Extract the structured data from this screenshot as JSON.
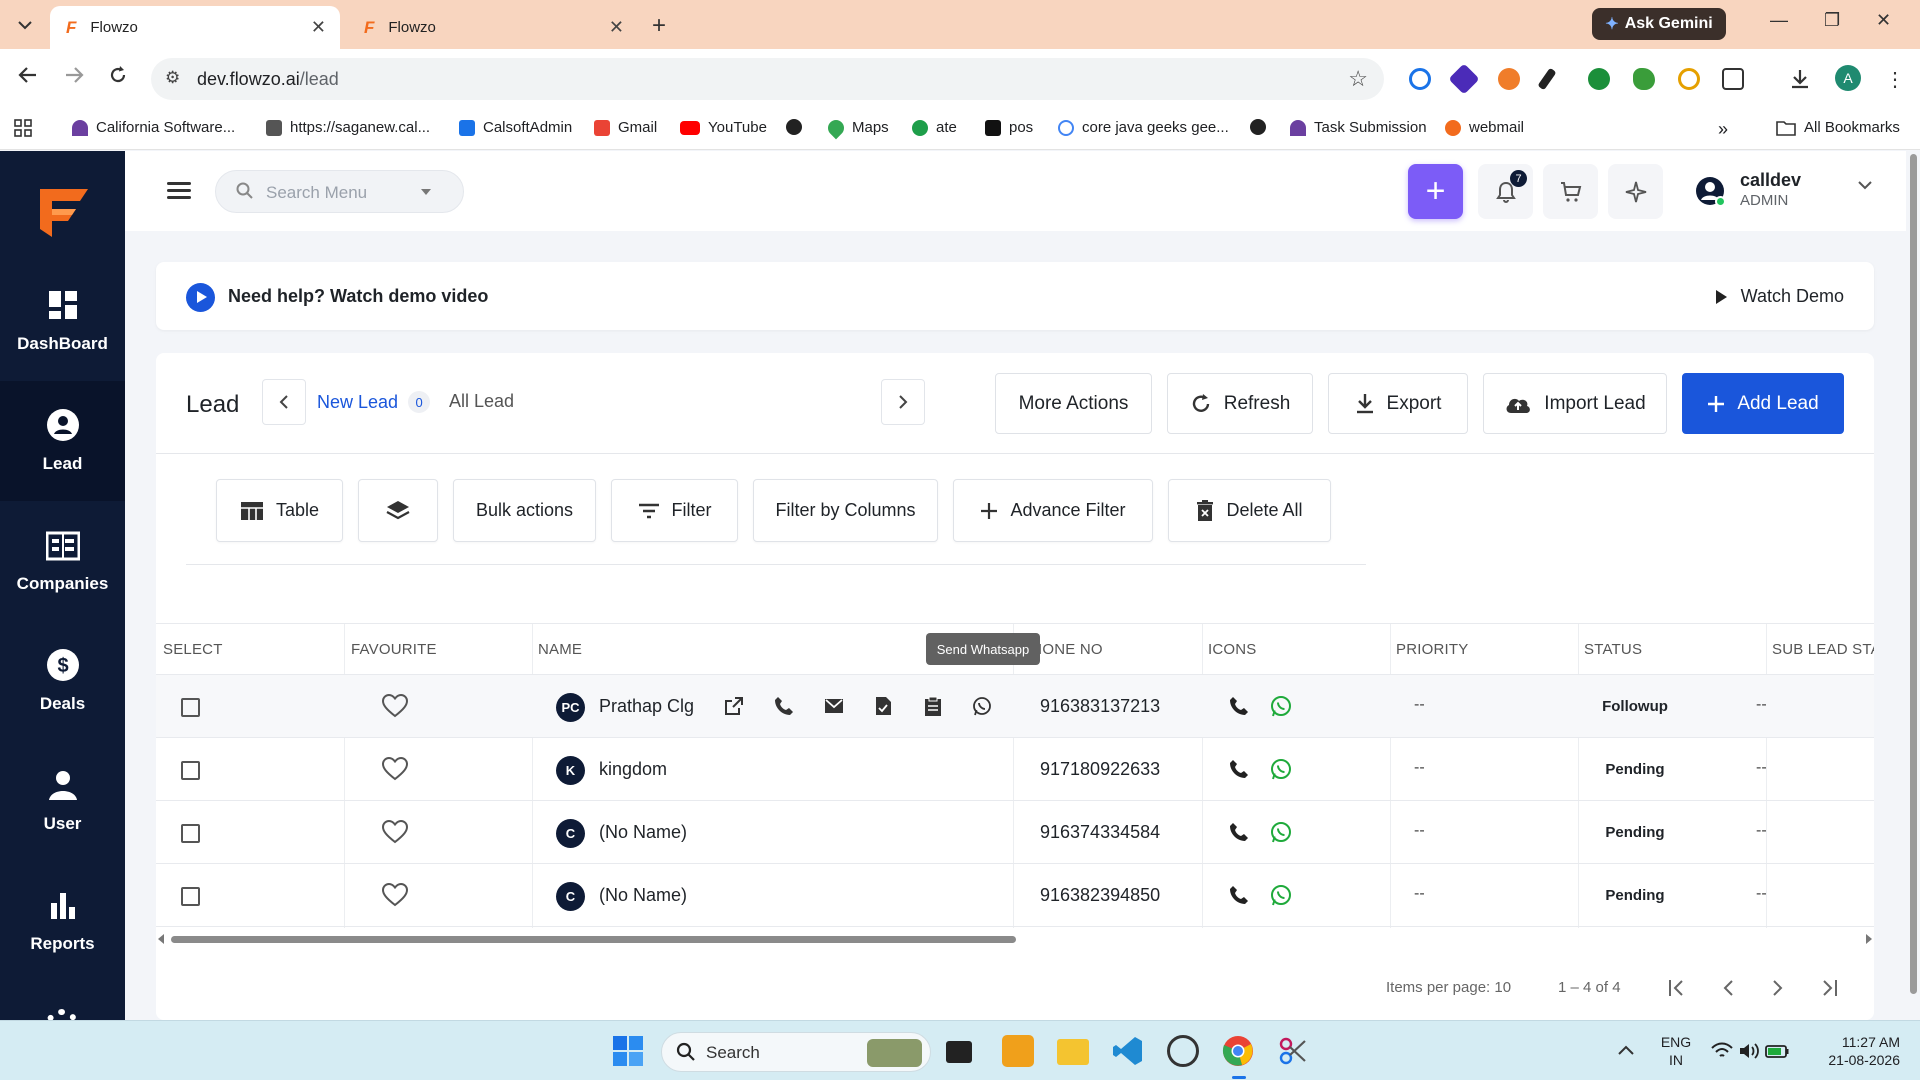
{
  "browser": {
    "tabs": [
      {
        "title": "Flowzo",
        "active": true
      },
      {
        "title": "Flowzo",
        "active": false
      }
    ],
    "gemini_label": "Ask Gemini",
    "url_host": "dev.flowzo.ai",
    "url_path": "/lead",
    "bookmarks": [
      "California Software...",
      "https://saganew.cal...",
      "CalsoftAdmin",
      "Gmail",
      "YouTube",
      "Maps",
      "ate",
      "pos",
      "core java geeks gee...",
      "Task Submission",
      "webmail"
    ],
    "all_bookmarks": "All Bookmarks",
    "profile_initial": "A"
  },
  "sidebar": {
    "items": [
      {
        "label": "DashBoard",
        "icon": "dashboard-icon"
      },
      {
        "label": "Lead",
        "icon": "person-circle-icon",
        "active": true
      },
      {
        "label": "Companies",
        "icon": "companies-icon"
      },
      {
        "label": "Deals",
        "icon": "dollar-icon"
      },
      {
        "label": "User",
        "icon": "user-icon"
      },
      {
        "label": "Reports",
        "icon": "bar-chart-icon"
      }
    ]
  },
  "header": {
    "search_placeholder": "Search Menu",
    "notification_count": "7",
    "user_name": "calldev",
    "user_role": "ADMIN"
  },
  "help": {
    "text": "Need help? Watch demo video",
    "watch_label": "Watch Demo"
  },
  "lead": {
    "title": "Lead",
    "tab_new": "New Lead",
    "tab_new_count": "0",
    "tab_all": "All Lead",
    "actions": {
      "more": "More Actions",
      "refresh": "Refresh",
      "export": "Export",
      "import": "Import Lead",
      "add": "Add Lead"
    },
    "filters": {
      "table": "Table",
      "bulk": "Bulk actions",
      "filter": "Filter",
      "filter_columns": "Filter by Columns",
      "advance": "Advance Filter",
      "delete_all": "Delete All"
    },
    "tooltip": "Send Whatsapp",
    "columns": [
      "SELECT",
      "FAVOURITE",
      "NAME",
      "IONE NO",
      "ICONS",
      "PRIORITY",
      "STATUS",
      "SUB LEAD STA"
    ],
    "rows": [
      {
        "initials": "PC",
        "name": "Prathap Clg",
        "phone": "916383137213",
        "priority": "--",
        "status": "Followup",
        "sub_status": "--"
      },
      {
        "initials": "K",
        "name": "kingdom",
        "phone": "917180922633",
        "priority": "--",
        "status": "Pending",
        "sub_status": "--"
      },
      {
        "initials": "C",
        "name": "(No Name)",
        "phone": "916374334584",
        "priority": "--",
        "status": "Pending",
        "sub_status": "--"
      },
      {
        "initials": "C",
        "name": "(No Name)",
        "phone": "916382394850",
        "priority": "--",
        "status": "Pending",
        "sub_status": "--"
      }
    ],
    "paginator": {
      "items_per_page": "Items per page: 10",
      "range": "1 – 4 of 4"
    }
  },
  "taskbar": {
    "search_label": "Search",
    "lang": "ENG",
    "region": "IN",
    "time": "11:27 AM",
    "date": "21-08-2026"
  },
  "colors": {
    "sidebar_bg": "#0e1b36",
    "primary": "#1a56db",
    "accent_purple": "#7c5cf7",
    "tab_strip": "#f8d5bf"
  }
}
